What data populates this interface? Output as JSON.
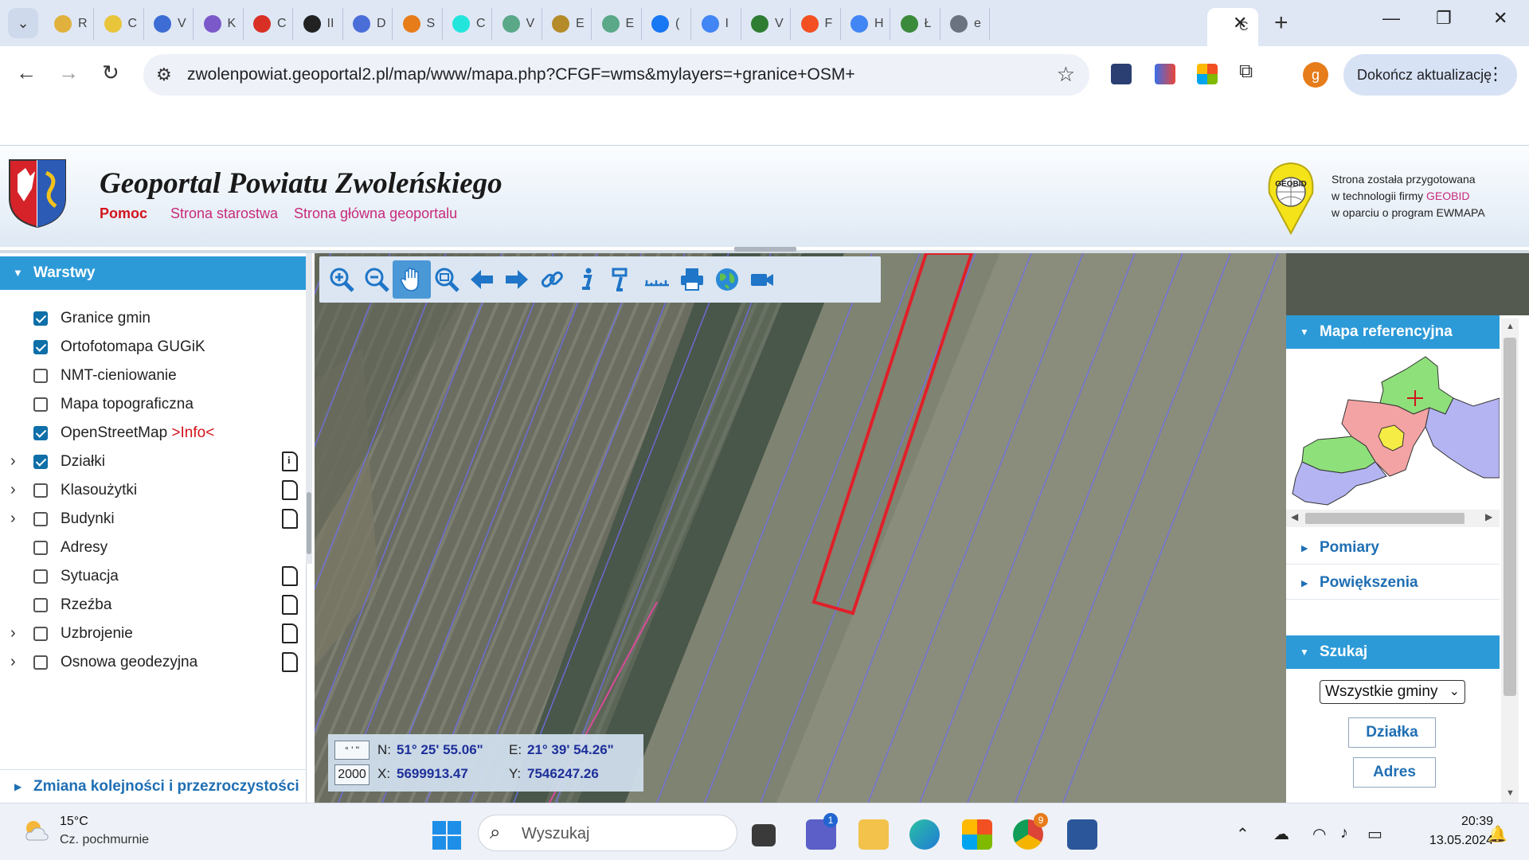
{
  "browser": {
    "tabs": [
      {
        "label": "R",
        "icon": "yellow-circle-icon",
        "color": "#e0b13c"
      },
      {
        "label": "C",
        "icon": "sun-icon",
        "color": "#e8c53a"
      },
      {
        "label": "V",
        "icon": "tv-icon",
        "color": "#3d6cd4"
      },
      {
        "label": "K",
        "icon": "spinner-icon",
        "color": "#7b59c9"
      },
      {
        "label": "C",
        "icon": "gmail-icon",
        "color": "#d93025"
      },
      {
        "label": "II",
        "icon": "dark-app-icon",
        "color": "#222222"
      },
      {
        "label": "D",
        "icon": "f-circle-icon",
        "color": "#4a6ed8"
      },
      {
        "label": "S",
        "icon": "ball-icon",
        "color": "#e67c1a"
      },
      {
        "label": "C",
        "icon": "olx-icon",
        "color": "#23e5db"
      },
      {
        "label": "V",
        "icon": "openai-icon",
        "color": "#5aa888"
      },
      {
        "label": "E",
        "icon": "a-circle-icon",
        "color": "#b58b2a"
      },
      {
        "label": "E",
        "icon": "e-circle-icon",
        "color": "#5aa888"
      },
      {
        "label": "(",
        "icon": "facebook-icon",
        "color": "#1877f2"
      },
      {
        "label": "I",
        "icon": "google-icon",
        "color": "#4285f4"
      },
      {
        "label": "V",
        "icon": "leaf-icon",
        "color": "#2e7d32"
      },
      {
        "label": "F",
        "icon": "microsoft-icon",
        "color": "#f25022"
      },
      {
        "label": "H",
        "icon": "google-icon",
        "color": "#4285f4"
      },
      {
        "label": "Ł",
        "icon": "hill-icon",
        "color": "#3b8a3b"
      },
      {
        "label": "e",
        "icon": "globe-icon",
        "color": "#6b7280"
      },
      {
        "label": "C",
        "icon": "active-tab-icon",
        "color": "#ffffff"
      }
    ],
    "url": "zwolenpowiat.geoportal2.pl/map/www/mapa.php?CFGF=wms&mylayers=+granice+OSM+",
    "profile_initial": "g",
    "update_label": "Dokończ aktualizację"
  },
  "header": {
    "title": "Geoportal Powiatu Zwoleńskiego",
    "links": [
      "Pomoc",
      "Strona starostwa",
      "Strona główna geoportalu"
    ],
    "geobid_line1": "Strona została przygotowana",
    "geobid_line2_pre": "w technologii firmy ",
    "geobid_line2_accent": "GEOBID",
    "geobid_line3": "w oparciu o program EWMAPA",
    "geobid_logo_text": "GEOBID"
  },
  "layers_panel": {
    "title": "Warstwy",
    "items": [
      {
        "label": "Granice gmin",
        "checked": true,
        "expandable": false,
        "doc": "none"
      },
      {
        "label": "Ortofotomapa GUGiK",
        "checked": true,
        "expandable": false,
        "doc": "none"
      },
      {
        "label": "NMT-cieniowanie",
        "checked": false,
        "expandable": false,
        "doc": "none"
      },
      {
        "label": "Mapa topograficzna",
        "checked": false,
        "expandable": false,
        "doc": "none"
      },
      {
        "label": "OpenStreetMap ",
        "info": ">Info<",
        "checked": true,
        "expandable": false,
        "doc": "none"
      },
      {
        "label": "Działki",
        "checked": true,
        "expandable": true,
        "doc": "info"
      },
      {
        "label": "Klasoużytki",
        "checked": false,
        "expandable": true,
        "doc": "plain"
      },
      {
        "label": "Budynki",
        "checked": false,
        "expandable": true,
        "doc": "plain"
      },
      {
        "label": "Adresy",
        "checked": false,
        "expandable": false,
        "doc": "none"
      },
      {
        "label": "Sytuacja",
        "checked": false,
        "expandable": false,
        "doc": "plain"
      },
      {
        "label": "Rzeźba",
        "checked": false,
        "expandable": false,
        "doc": "plain"
      },
      {
        "label": "Uzbrojenie",
        "checked": false,
        "expandable": true,
        "doc": "plain"
      },
      {
        "label": "Osnowa geodezyjna",
        "checked": false,
        "expandable": true,
        "doc": "plain"
      }
    ],
    "order_link": "Zmiana kolejności i przezroczystości"
  },
  "map_tools": [
    "zoom-in-icon",
    "zoom-out-icon",
    "pan-hand-icon",
    "zoom-window-icon",
    "back-arrow-icon",
    "forward-arrow-icon",
    "link-icon",
    "info-icon",
    "feature-info-icon",
    "measure-icon",
    "print-icon",
    "globe-icon",
    "video-icon"
  ],
  "view_tools": [
    "full-width-icon",
    "split-view-icon",
    "enter-icon",
    "right-panel-icon"
  ],
  "coords": {
    "unit": "° ' \"",
    "scale": "2000",
    "n_label": "N:",
    "n_value": "51° 25' 55.06\"",
    "e_label": "E:",
    "e_value": "21° 39' 54.26\"",
    "x_label": "X:",
    "x_value": "5699913.47",
    "y_label": "Y:",
    "y_value": "7546247.26"
  },
  "right_panel": {
    "ref_map_title": "Mapa referencyjna",
    "measurements": "Pomiary",
    "zooms": "Powiększenia",
    "search_title": "Szukaj",
    "select_value": "Wszystkie gminy",
    "btn_parcel": "Działka",
    "btn_address": "Adres"
  },
  "taskbar": {
    "temp": "15°C",
    "weather": "Cz. pochmurnie",
    "search_placeholder": "Wyszukaj",
    "teams_badge": "1",
    "chrome_badge": "9",
    "time": "20:39",
    "date": "13.05.2024"
  },
  "colors": {
    "accent": "#2d9ad8",
    "link": "#c72a7b",
    "parcel_outline": "#e0202a"
  }
}
